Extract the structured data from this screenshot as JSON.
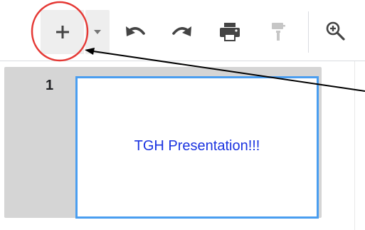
{
  "toolbar": {
    "new_slide_button": {
      "icon": "plus-icon"
    },
    "new_slide_dropdown": {
      "icon": "caret-down-icon"
    },
    "undo_button": {
      "icon": "undo-icon"
    },
    "redo_button": {
      "icon": "redo-icon"
    },
    "print_button": {
      "icon": "print-icon"
    },
    "paint_format_button": {
      "icon": "paint-roller-icon",
      "state": "disabled"
    },
    "zoom_button": {
      "icon": "zoom-in-icon"
    }
  },
  "filmstrip": {
    "slides": [
      {
        "number": "1",
        "title": "TGH Presentation!!!"
      }
    ]
  },
  "colors": {
    "annotation_circle": "#e53935",
    "selected_slide_border": "#4a9ef0",
    "slide_title_text": "#1a33e0",
    "filmstrip_panel": "#d5d5d5"
  },
  "annotations": [
    {
      "type": "circle",
      "target": "new-slide-button"
    },
    {
      "type": "arrow",
      "target": "new-slide-button"
    }
  ]
}
